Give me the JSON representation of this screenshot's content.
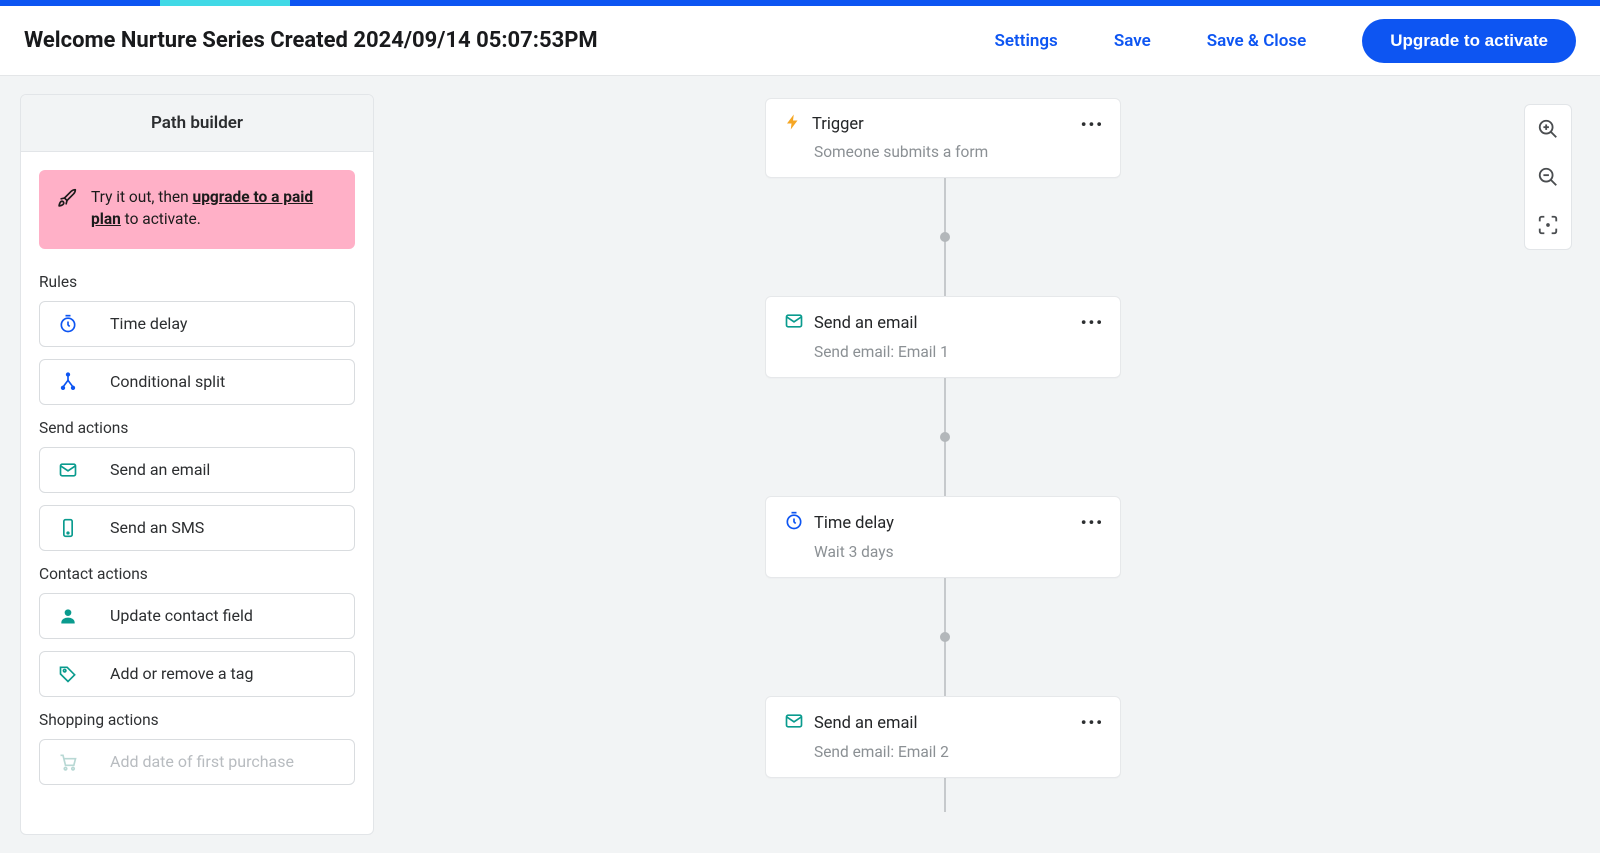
{
  "header": {
    "title": "Welcome Nurture Series Created 2024/09/14 05:07:53PM",
    "settings": "Settings",
    "save": "Save",
    "save_close": "Save & Close",
    "upgrade": "Upgrade to activate"
  },
  "sidebar": {
    "title": "Path builder",
    "promo_pre": "Try it out, then ",
    "promo_link": "upgrade to a paid plan",
    "promo_post": " to activate.",
    "sections": {
      "rules": {
        "title": "Rules",
        "items": [
          {
            "label": "Time delay",
            "icon": "timer",
            "color": "blue"
          },
          {
            "label": "Conditional split",
            "icon": "split",
            "color": "blue"
          }
        ]
      },
      "send": {
        "title": "Send actions",
        "items": [
          {
            "label": "Send an email",
            "icon": "mail",
            "color": "teal"
          },
          {
            "label": "Send an SMS",
            "icon": "phone",
            "color": "teal"
          }
        ]
      },
      "contact": {
        "title": "Contact actions",
        "items": [
          {
            "label": "Update contact field",
            "icon": "person",
            "color": "teal"
          },
          {
            "label": "Add or remove a tag",
            "icon": "tag",
            "color": "teal"
          }
        ]
      },
      "shopping": {
        "title": "Shopping actions",
        "items": [
          {
            "label": "Add date of first purchase",
            "icon": "cart",
            "color": "teal",
            "disabled": true
          }
        ]
      }
    }
  },
  "flow": [
    {
      "title": "Trigger",
      "sub": "Someone submits a form",
      "icon": "bolt",
      "color": "orange"
    },
    {
      "title": "Send an email",
      "sub": "Send email: Email 1",
      "icon": "mail",
      "color": "teal"
    },
    {
      "title": "Time delay",
      "sub": "Wait 3 days",
      "icon": "timer",
      "color": "blue"
    },
    {
      "title": "Send an email",
      "sub": "Send email: Email 2",
      "icon": "mail",
      "color": "teal"
    }
  ]
}
